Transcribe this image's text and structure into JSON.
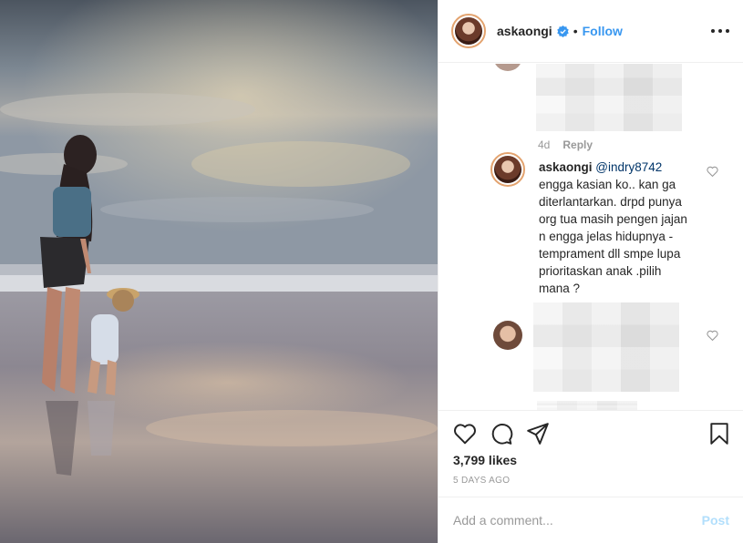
{
  "header": {
    "username": "askaongi",
    "separator": "•",
    "follow_label": "Follow"
  },
  "comments": {
    "first_comment": {
      "time": "4d",
      "reply_label": "Reply"
    },
    "main_comment": {
      "username": "askaongi",
      "mention": "@indry8742",
      "text": "engga kasian ko.. kan ga diterlantarkan. drpd punya org tua masih pengen jajan n engga jelas hidupnya - temprament dll smpe lupa prioritaskan anak .pilih mana ?"
    }
  },
  "actions": {
    "likes": "3,799 likes",
    "date": "5 DAYS AGO"
  },
  "add_comment": {
    "placeholder": "Add a comment...",
    "post_label": "Post"
  },
  "colors": {
    "link_blue": "#3897f0",
    "post_disabled": "#b2dffc",
    "avatar_ring": "#e3a36f"
  }
}
